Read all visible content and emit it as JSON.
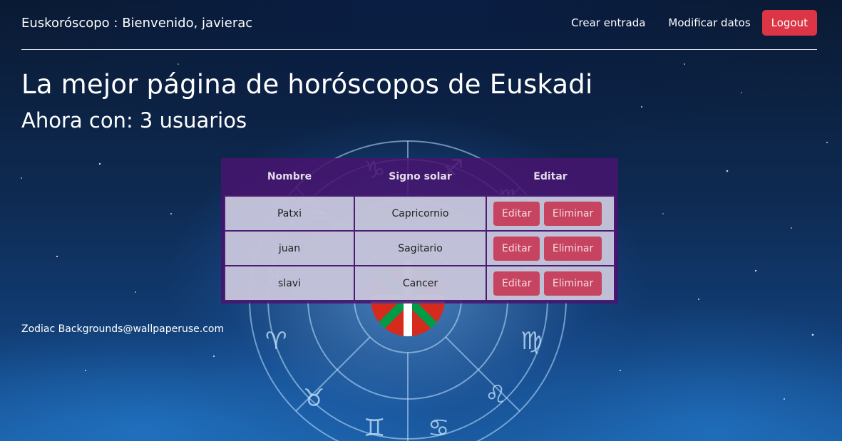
{
  "navbar": {
    "brand": "Euskoróscopo : Bienvenido, javierac",
    "links": [
      "Crear entrada",
      "Modificar datos"
    ],
    "logout_label": "Logout",
    "logout_color": "#dc3545"
  },
  "hero": {
    "title": "La mejor página de horóscopos de Euskadi",
    "subtitle": "Ahora con: 3 usuarios"
  },
  "table": {
    "headers": [
      "Nombre",
      "Signo solar",
      "Editar"
    ],
    "rows": [
      {
        "nombre": "Patxi",
        "signo": "Capricornio"
      },
      {
        "nombre": "juan",
        "signo": "Sagitario"
      },
      {
        "nombre": "slavi",
        "signo": "Cancer"
      }
    ],
    "edit_label": "Editar",
    "delete_label": "Eliminar",
    "header_color": "#46146e"
  },
  "footer": {
    "credit": "Zodiac Backgrounds@wallpaperuse.com"
  }
}
